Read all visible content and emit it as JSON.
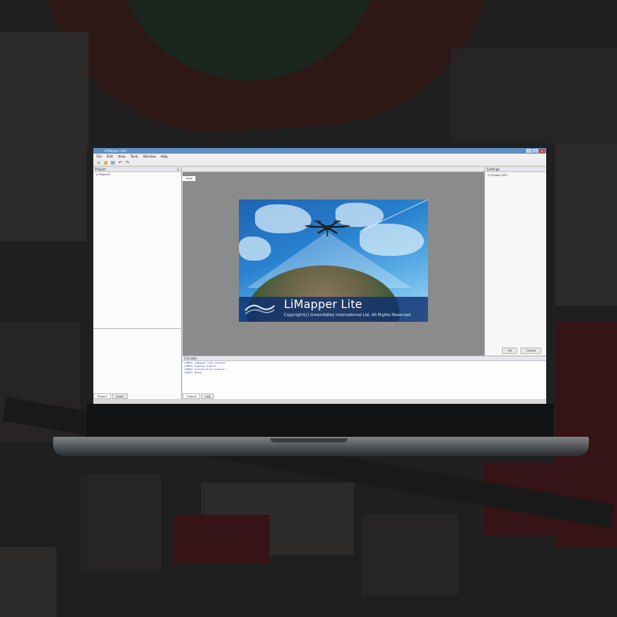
{
  "window": {
    "title": "LiMapper Lite",
    "controls": {
      "minimize": "–",
      "maximize": "□",
      "close": "×"
    }
  },
  "menu": [
    "File",
    "Edit",
    "View",
    "Tools",
    "Window",
    "Help"
  ],
  "toolbar": {
    "icons": [
      "new-file-icon",
      "open-folder-icon",
      "save-icon",
      "undo-icon",
      "redo-icon"
    ],
    "glyphs": [
      "▫",
      "▣",
      "▤",
      "↶",
      "↷"
    ]
  },
  "left_panel": {
    "header": "Project",
    "close": "×",
    "tree_items": [
      "▸ Project1"
    ],
    "tabs": [
      "Project",
      "Layer"
    ]
  },
  "center": {
    "tab": "View"
  },
  "splash": {
    "title": "LiMapper Lite",
    "copyright": "Copyright(c) GreenValley International Ltd. All Rights Reserved."
  },
  "right_panel": {
    "header": "Settings",
    "items": [
      "☑ Enable GPU"
    ],
    "buttons": [
      "OK",
      "Cancel"
    ]
  },
  "console": {
    "header": "Console",
    "lines": [
      "[INFO] LiMapper Lite started",
      "[INFO] Loading plugins ...",
      "[INFO] Initializing renderer ...",
      "[INFO] Ready"
    ],
    "tabs": [
      "Output",
      "Log"
    ]
  },
  "colors": {
    "titlebar": "#5e8fc0",
    "splash_blue": "#1c63b4",
    "splash_footer": "#0e306e",
    "background_overlay": "#0a0a0c"
  }
}
